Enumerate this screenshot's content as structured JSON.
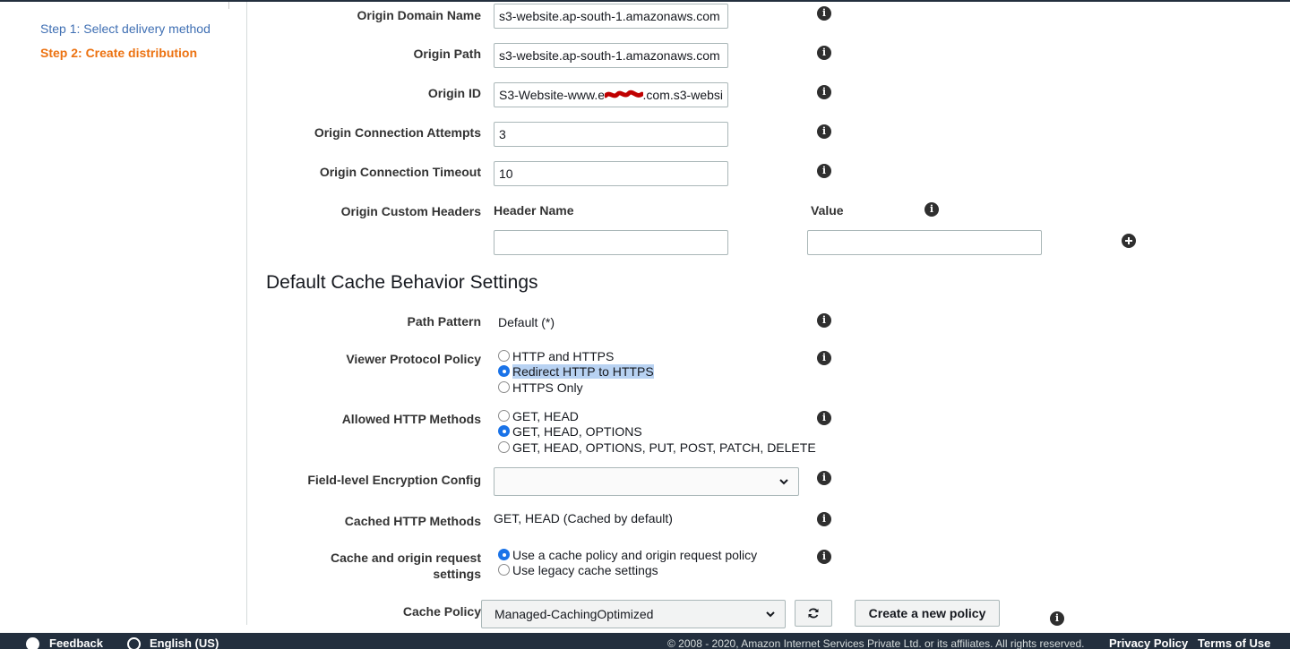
{
  "steps": {
    "step1": "Step 1: Select delivery method",
    "step2": "Step 2: Create distribution"
  },
  "origin": {
    "domain_name": {
      "label": "Origin Domain Name",
      "value": "s3-website.ap-south-1.amazonaws.com"
    },
    "path": {
      "label": "Origin Path",
      "value": "s3-website.ap-south-1.amazonaws.com"
    },
    "id": {
      "label": "Origin ID",
      "value_prefix": "S3-Website-www.e",
      "value_suffix": ".com.s3-websi"
    },
    "attempts": {
      "label": "Origin Connection Attempts",
      "value": "3"
    },
    "timeout": {
      "label": "Origin Connection Timeout",
      "value": "10"
    },
    "custom_headers": {
      "label": "Origin Custom Headers",
      "header_name": "Header Name",
      "value": "Value",
      "header_name_value": "",
      "value_value": ""
    }
  },
  "cache": {
    "section_title": "Default Cache Behavior Settings",
    "path_pattern": {
      "label": "Path Pattern",
      "value": "Default (*)"
    },
    "viewer_protocol": {
      "label": "Viewer Protocol Policy",
      "options": [
        "HTTP and HTTPS",
        "Redirect HTTP to HTTPS",
        "HTTPS Only"
      ],
      "selected": "Redirect HTTP to HTTPS"
    },
    "allowed_methods": {
      "label": "Allowed HTTP Methods",
      "options": [
        "GET, HEAD",
        "GET, HEAD, OPTIONS",
        "GET, HEAD, OPTIONS, PUT, POST, PATCH, DELETE"
      ],
      "selected": "GET, HEAD, OPTIONS"
    },
    "field_encryption": {
      "label": "Field-level Encryption Config",
      "value": ""
    },
    "cached_methods": {
      "label": "Cached HTTP Methods",
      "value": "GET, HEAD (Cached by default)"
    },
    "cache_origin_policy": {
      "label_line1": "Cache and origin request",
      "label_line2": "settings",
      "options": [
        "Use a cache policy and origin request policy",
        "Use legacy cache settings"
      ],
      "selected": "Use a cache policy and origin request policy"
    },
    "cache_policy": {
      "label": "Cache Policy",
      "value": "Managed-CachingOptimized",
      "create_button": "Create a new policy"
    }
  },
  "footer": {
    "feedback": "Feedback",
    "language": "English (US)",
    "copyright": "© 2008 - 2020, Amazon Internet Services Private Ltd. or its affiliates. All rights reserved.",
    "privacy": "Privacy Policy",
    "terms": "Terms of Use"
  },
  "colors": {
    "step_link": "#3f6fb3",
    "step_active": "#ec7211",
    "radio_selected": "#1a73e8",
    "footer_bg": "#232f3e",
    "highlight": "#b8d2f2"
  },
  "icons": [
    "info-icon",
    "add-circle-icon",
    "chevron-down-icon",
    "refresh-icon",
    "feedback-bubble-icon",
    "globe-icon"
  ]
}
